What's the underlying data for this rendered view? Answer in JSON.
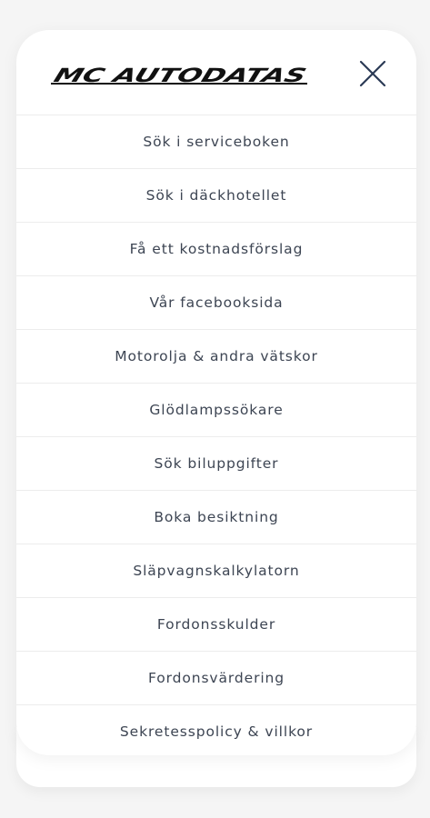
{
  "header": {
    "logo_text": "MC AUTODATAS",
    "close_icon": "close-icon"
  },
  "menu": {
    "items": [
      {
        "label": "Sök i serviceboken"
      },
      {
        "label": "Sök i däckhotellet"
      },
      {
        "label": "Få ett kostnadsförslag"
      },
      {
        "label": "Vår facebooksida"
      },
      {
        "label": "Motorolja & andra vätskor"
      },
      {
        "label": "Glödlampssökare"
      },
      {
        "label": "Sök biluppgifter"
      },
      {
        "label": "Boka besiktning"
      },
      {
        "label": "Släpvagnskalkylatorn"
      },
      {
        "label": "Fordonsskulder"
      },
      {
        "label": "Fordonsvärdering"
      },
      {
        "label": "Sekretesspolicy & villkor"
      }
    ]
  },
  "colors": {
    "page_bg": "#f5f5f5",
    "card_bg": "#ffffff",
    "divider": "#ececec",
    "menu_text": "#3d4553",
    "close_icon": "#2b3a55",
    "logo": "#111111"
  }
}
